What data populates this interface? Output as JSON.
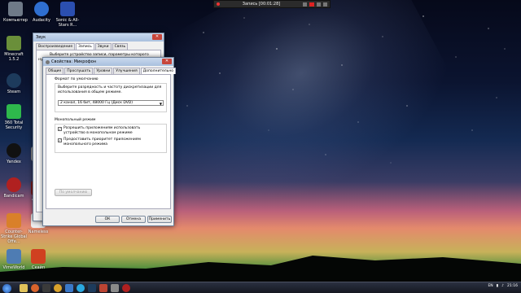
{
  "desktop_icons": [
    {
      "label": "Компьютер",
      "color": "#6f7a88"
    },
    {
      "label": "Audacity",
      "color": "#2f6fd0"
    },
    {
      "label": "Sonic & All-Stars R...",
      "color": "#2b4fb0"
    },
    {
      "label": "Minecraft 1.5.2",
      "color": "#6a8f3a"
    },
    {
      "label": "Steam",
      "color": "#1d3b5c"
    },
    {
      "label": "360 Total Security",
      "color": "#2eb84c"
    },
    {
      "label": "Yandex",
      "color": "#111111"
    },
    {
      "label": "Bandicam",
      "color": "#b02020"
    },
    {
      "label": "Counter-Strike Global Offe...",
      "color": "#d9802a"
    },
    {
      "label": "Nameless",
      "color": "#eeeeee"
    },
    {
      "label": "VimeWorld",
      "color": "#4e7cb3"
    },
    {
      "label": "Скайп",
      "color": "#d04020"
    },
    {
      "label": "Action",
      "color": "#7a1a1a"
    },
    {
      "label": "Co",
      "color": "#8a8a8a"
    }
  ],
  "recording_bar": {
    "title": "Запись [00:01:28]"
  },
  "back_window": {
    "title": "Звук",
    "tabs": [
      "Воспроизведение",
      "Запись",
      "Звуки",
      "Связь"
    ],
    "hint": "Выберите устройство записи, параметры которого нужно изменить:"
  },
  "dialog": {
    "title": "Свойства: Микрофон",
    "tabs": [
      "Общие",
      "Прослушать",
      "Уровни",
      "Улучшения",
      "Дополнительно"
    ],
    "active_tab": "Дополнительно",
    "default_format": {
      "group_title": "Формат по умолчанию",
      "description": "Выберите разрядность и частоту дискретизации для использования в общем режиме.",
      "selected": "2 канал, 16 бит, 48000 Гц (Диск DVD)"
    },
    "exclusive_mode": {
      "group_title": "Монопольный режим",
      "option_1": "Разрешить приложениям использовать устройство в монопольном режиме",
      "option_2": "Предоставить приоритет приложениям монопольного режима",
      "option_1_checked": true,
      "option_2_checked": true
    },
    "defaults_button": "По умолчанию",
    "ok_button": "ОК",
    "cancel_button": "Отмена",
    "apply_button": "Применить"
  },
  "taskbar": {
    "language": "EN",
    "time": "21:16"
  }
}
